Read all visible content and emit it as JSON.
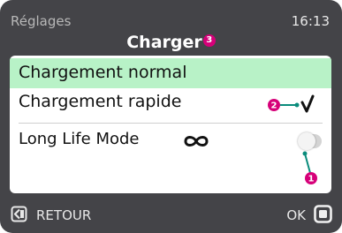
{
  "header": {
    "section": "Réglages",
    "time": "16:13",
    "title": "Charger",
    "title_badge": "3"
  },
  "options": [
    {
      "label": "Chargement normal",
      "highlighted": true
    },
    {
      "label": "Chargement rapide",
      "selected": true,
      "callout": "2"
    },
    {
      "label": "Long Life Mode",
      "icon": "infinity-icon",
      "toggle_on": false,
      "callout": "1"
    }
  ],
  "footer": {
    "back_label": "RETOUR",
    "back_icon": "back-icon",
    "ok_label": "OK",
    "ok_icon": "ok-square-icon"
  },
  "colors": {
    "background": "#444448",
    "highlight": "#b8f2c7",
    "callout_magenta": "#d60079",
    "callout_teal": "#0a8c7c"
  }
}
